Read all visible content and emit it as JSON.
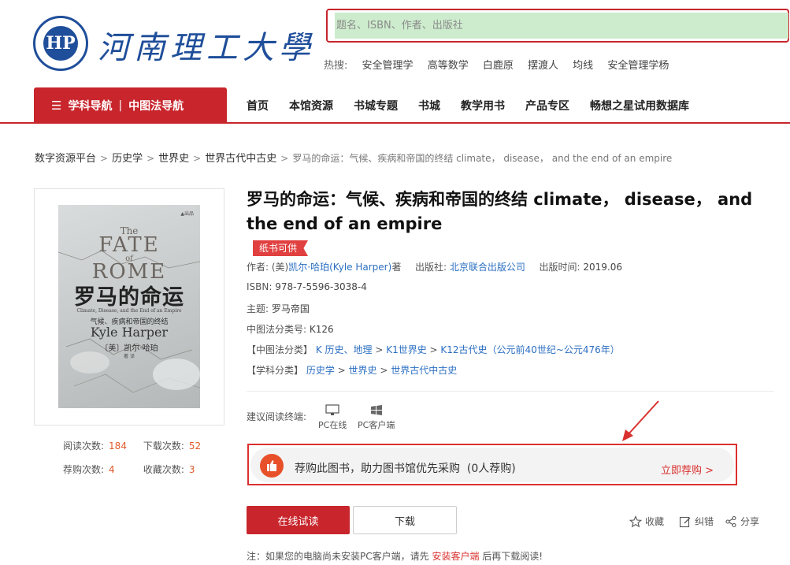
{
  "header": {
    "logo_text": "河南理工大學",
    "logo_mark": "HP",
    "search_placeholder": "题名、ISBN、作者、出版社",
    "hot_label": "热搜:",
    "hot_items": [
      "安全管理学",
      "高等数学",
      "白鹿原",
      "摆渡人",
      "均线",
      "安全管理学杨"
    ]
  },
  "nav": {
    "category_label": "学科导航",
    "clc_label": "中图法导航",
    "items": [
      "首页",
      "本馆资源",
      "书城专题",
      "书城",
      "教学用书",
      "产品专区",
      "畅想之星试用数据库"
    ]
  },
  "breadcrumb": {
    "items": [
      "数字资源平台",
      "历史学",
      "世界史",
      "世界古代中古史"
    ],
    "current": "罗马的命运：气候、疾病和帝国的终结 climate， disease， and the end of an empire"
  },
  "cover": {
    "top_mark": "▲出品",
    "title_lines": [
      "The",
      "FATE",
      "of",
      "ROME"
    ],
    "title_zh": "罗马的命运",
    "subtitle_en": "Climate, Disease, and the End of an Empire",
    "subtitle_zh": "气候、疾病和帝国的终结",
    "author_en": "Kyle Harper",
    "author_zh": "〔美〕凯尔·哈珀",
    "translator": "著 译"
  },
  "stats": {
    "read_label": "阅读次数:",
    "read_value": "184",
    "download_label": "下载次数:",
    "download_value": "52",
    "recommend_label": "荐购次数:",
    "recommend_value": "4",
    "favorite_label": "收藏次数:",
    "favorite_value": "3"
  },
  "book": {
    "title": "罗马的命运：气候、疾病和帝国的终结 climate， disease， and the end of an empire",
    "tag": "纸书可供",
    "author_label": "作者:",
    "author_prefix": "(美)",
    "author": "凯尔·哈珀(Kyle Harper)",
    "author_suffix": "著",
    "publisher_label": "出版社:",
    "publisher": "北京联合出版公司",
    "pubdate_label": "出版时间:",
    "pubdate": "2019.06",
    "isbn_label": "ISBN:",
    "isbn": "978-7-5596-3038-4",
    "subject_label": "主题:",
    "subject": "罗马帝国",
    "clc_label": "中图法分类号:",
    "clc": "K126",
    "clc_path_label": "【中图法分类】",
    "clc_path": [
      "K 历史、地理",
      "K1世界史",
      "K12古代史（公元前40世纪~公元476年）"
    ],
    "discipline_label": "【学科分类】",
    "discipline_path": [
      "历史学",
      "世界史",
      "世界古代中古史"
    ]
  },
  "terminals": {
    "label": "建议阅读终端:",
    "items": [
      "PC在线",
      "PC客户端"
    ]
  },
  "promo": {
    "text": "荐购此图书，助力图书馆优先采购",
    "count": "(0人荐购)",
    "action": "立即荐购 >"
  },
  "actions": {
    "read_online": "在线试读",
    "download": "下载",
    "favorite": "收藏",
    "correct": "纠错",
    "share": "分享"
  },
  "note": {
    "prefix": "注：如果您的电脑尚未安装PC客户端，请先",
    "link": "安装客户端",
    "suffix": "后再下载阅读!"
  },
  "colors": {
    "brand_red": "#c8252c",
    "link_blue": "#2c6fc2",
    "accent_orange": "#e8502a",
    "logo_blue": "#1f4e9a"
  }
}
